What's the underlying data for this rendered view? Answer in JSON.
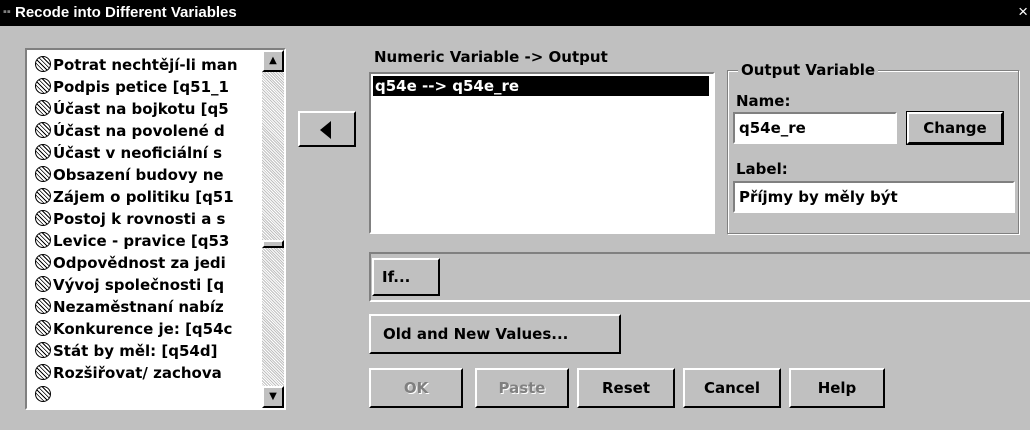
{
  "window": {
    "title": "Recode into Different Variables",
    "close": "×"
  },
  "variables": [
    "Potrat nechtějí-li man",
    "Podpis petice [q51_1",
    "Účast na bojkotu [q5",
    "Účast na povolené d",
    "Účast v neoficiální s",
    "Obsazení budovy ne",
    "Zájem o politiku [q51",
    "Postoj k rovnosti a s",
    "Levice - pravice [q53",
    "Odpovědnost za jedi",
    "Vývoj společnosti [q",
    "Nezaměstnaní nabíz",
    "Konkurence je: [q54c",
    "Stát by měl: [q54d]",
    "Rozšiřovat/ zachova"
  ],
  "scroll": {
    "up": "▲",
    "down": "▼",
    "thumb_position": 0.55
  },
  "numeric": {
    "label": "Numeric Variable -> Output",
    "items": [
      "q54e --> q54e_re"
    ]
  },
  "output": {
    "legend": "Output Variable",
    "name_label": "Name:",
    "name_value": "q54e_re",
    "change_button": "Change",
    "label_label": "Label:",
    "label_value": "Příjmy by měly být"
  },
  "buttons": {
    "if": "If...",
    "old_new": "Old and New Values...",
    "ok": "OK",
    "paste": "Paste",
    "reset": "Reset",
    "cancel": "Cancel",
    "help": "Help"
  }
}
